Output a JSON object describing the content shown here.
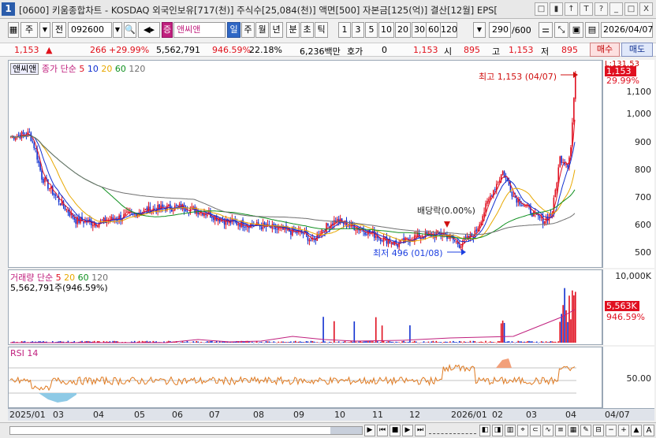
{
  "window": {
    "number": "1",
    "title": "[0600] 키움종합차트 - KOSDAQ 외국인보유[717(천)] 주식수[25,084(천)] 액면[500] 자본금[125(억)] 결산[12월] EPS[",
    "buttons": [
      "□",
      "▮",
      "↑",
      "T",
      "?",
      "_",
      "□",
      "X"
    ]
  },
  "toolbar": {
    "period_type": "주",
    "prev_btn": "전",
    "code": "092600",
    "stock_badge": "증",
    "stock_name": "앤씨앤",
    "periods": [
      "일",
      "주",
      "월",
      "년",
      "분",
      "초",
      "틱"
    ],
    "active_period": "일",
    "intervals": [
      "1",
      "3",
      "5",
      "10",
      "20",
      "30",
      "60",
      "120"
    ],
    "count": "290",
    "count_total": "/600",
    "date": "2026/04/07"
  },
  "quote": {
    "price": "1,153",
    "arrow": "▲",
    "change": "266",
    "change_pct": "+29.99%",
    "volume": "5,562,791",
    "volume_ratio": "946.59%",
    "turnover": "22.18%",
    "amount": "6,236백만",
    "bid_label": "호가",
    "bid_value": "0",
    "bid_price": "1,153",
    "open_label": "시",
    "open": "895",
    "high_label": "고",
    "high": "1,153",
    "low_label": "저",
    "low": "895",
    "buy_btn": "매수",
    "sell_btn": "매도"
  },
  "price_pane": {
    "name_tag": "앤씨앤",
    "legend_title": "종가 단순",
    "ma": [
      "5",
      "10",
      "20",
      "60",
      "120"
    ],
    "ma_colors": [
      "#e01020",
      "#1030d0",
      "#e8a800",
      "#109020",
      "#707070"
    ],
    "top_label": "L:131.53",
    "current_price": "1,153",
    "current_pct": "29.99%",
    "high_note": "최고 1,153 (04/07)",
    "low_note": "최저 496 (01/08)",
    "dividend_note": "배당락(0.00%)",
    "y_ticks": [
      "1,100",
      "1,000",
      "900",
      "800",
      "700",
      "600",
      "500"
    ]
  },
  "volume_pane": {
    "legend_title": "거래량 단순",
    "ma": [
      "5",
      "20",
      "60",
      "120"
    ],
    "current": "5,562,791주(946.59%)",
    "max_label": "10,000K",
    "cur_label": "5,563K",
    "cur_pct": "946.59%"
  },
  "rsi_pane": {
    "legend": "RSI 14",
    "mid_label": "50.00"
  },
  "x_axis": {
    "months": [
      "2025/01",
      "03",
      "04",
      "05",
      "06",
      "07",
      "08",
      "09",
      "10",
      "11",
      "12",
      "2026/01",
      "02",
      "03",
      "04"
    ],
    "right_label": "04/07"
  },
  "chart_data": {
    "type": "candlestick",
    "symbol": "앤씨앤",
    "period": "일",
    "ylim": [
      460,
      1160
    ],
    "last_close": 1153,
    "period_high": 1153,
    "period_low": 496
  }
}
